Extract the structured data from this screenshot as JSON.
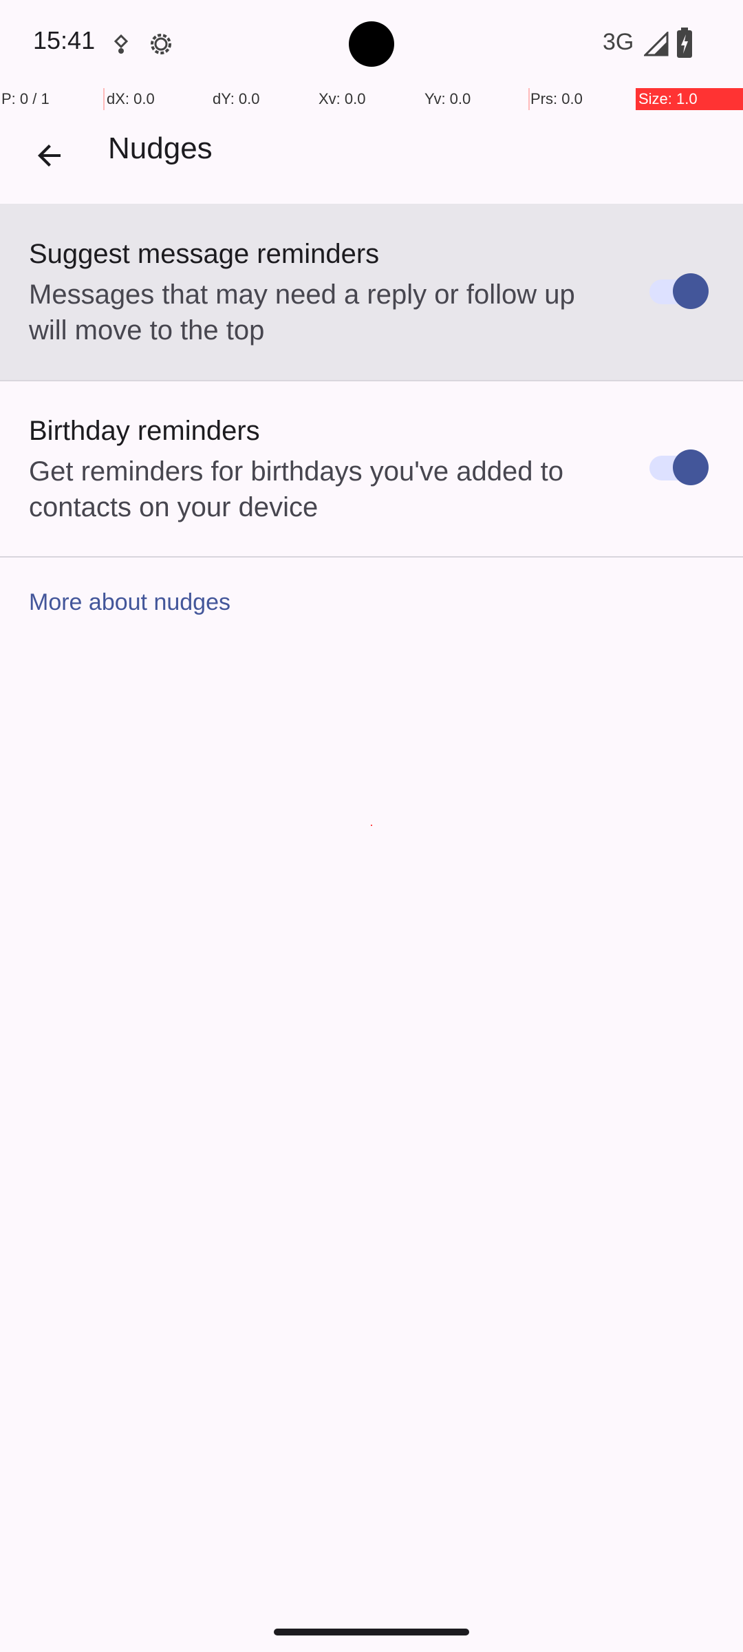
{
  "status_bar": {
    "time": "15:41",
    "network": "3G",
    "icons": [
      "notification-dot-icon",
      "settings-gear-icon",
      "signal-icon",
      "battery-charging-icon"
    ]
  },
  "debug_overlay": {
    "pointer": "P: 0 / 1",
    "dx": "dX: 0.0",
    "dy": "dY: 0.0",
    "xv": "Xv: 0.0",
    "yv": "Yv: 0.0",
    "prs": "Prs: 0.0",
    "size": "Size: 1.0"
  },
  "app_bar": {
    "title": "Nudges",
    "back_icon": "arrow-back-icon"
  },
  "preferences": [
    {
      "title": "Suggest message reminders",
      "summary": "Messages that may need a reply or follow up will move to the top",
      "enabled": true
    },
    {
      "title": "Birthday reminders",
      "summary": "Get reminders for birthdays you've added to contacts on your device",
      "enabled": true
    }
  ],
  "more_link": "More about nudges",
  "colors": {
    "accent": "#43569A",
    "track": "#DDE1FF",
    "background": "#FDF8FD",
    "highlight": "#E8E6EB"
  }
}
